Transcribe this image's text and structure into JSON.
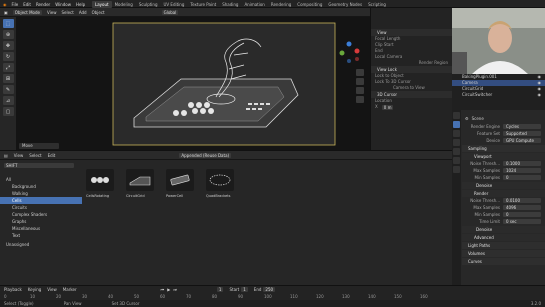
{
  "menu": [
    "File",
    "Edit",
    "Render",
    "Window",
    "Help"
  ],
  "workspaces": [
    "Layout",
    "Modeling",
    "Sculpting",
    "UV Editing",
    "Texture Paint",
    "Shading",
    "Animation",
    "Rendering",
    "Compositing",
    "Geometry Nodes",
    "Scripting"
  ],
  "viewport_header": {
    "mode": "Object Mode",
    "items": [
      "View",
      "Select",
      "Add",
      "Object"
    ],
    "orientation": "Global"
  },
  "viewport": {
    "move_label": "Move"
  },
  "npanel": {
    "section": "View",
    "focal_label": "Focal Length",
    "focal_value": "50 mm",
    "clip_start": "Clip Start",
    "clip_end": "End",
    "local_camera": "Local Camera",
    "render_region": "Render Region",
    "view_lock": "View Lock",
    "lock_obj": "Lock to Object",
    "lock": "Lock",
    "to_cursor": "To 3D Cursor",
    "camera_to_view": "Camera to View",
    "cursor_section": "3D Cursor",
    "location": "Location",
    "x": "X",
    "x_val": "0 m"
  },
  "outliner": {
    "items": [
      {
        "name": "BakingPlugin.001",
        "selected": false
      },
      {
        "name": "Camera",
        "selected": true
      },
      {
        "name": "CircuitGrid",
        "selected": false
      },
      {
        "name": "CircuitSwitcher",
        "selected": false
      }
    ]
  },
  "props": {
    "scene": "Scene",
    "render_engine_label": "Render Engine",
    "render_engine": "Cycles",
    "feature_set_label": "Feature Set",
    "feature_set": "Supported",
    "device_label": "Device",
    "device": "GPU Compute",
    "sampling": "Sampling",
    "viewport": "Viewport",
    "noise_label": "Noise Thresh...",
    "noise_val": "0.1000",
    "max_samples_label": "Max Samples",
    "max_samples": "1024",
    "min_samples_label": "Min Samples",
    "min_samples": "0",
    "denoise": "Denoise",
    "render": "Render",
    "r_noise_val": "0.0100",
    "r_max_samples": "4096",
    "r_min_samples": "0",
    "time_limit_label": "Time Limit",
    "time_limit": "0 sec",
    "r_denoise": "Denoise",
    "advanced": "Advanced",
    "light_paths": "Light Paths",
    "volumes": "Volumes",
    "curves": "Curves"
  },
  "browser": {
    "header": [
      "View",
      "Select",
      "Edit"
    ],
    "library": "Appended (Reuse Data)",
    "library_left": "SHIFT",
    "categories": [
      {
        "name": "All",
        "sel": false
      },
      {
        "name": "Background",
        "sel": false
      },
      {
        "name": "Walking",
        "sel": false
      },
      {
        "name": "Cells",
        "sel": true
      },
      {
        "name": "Circuits",
        "sel": false
      },
      {
        "name": "Complex Shaders",
        "sel": false
      },
      {
        "name": "Graphs",
        "sel": false
      },
      {
        "name": "Miscellaneous",
        "sel": false
      },
      {
        "name": "Text",
        "sel": false
      },
      {
        "name": "Unassigned",
        "sel": false
      }
    ],
    "assets": [
      "CellsRotating",
      "CircuitGrid",
      "PowerCell",
      "QuadBrackets"
    ]
  },
  "timeline": {
    "items": [
      "Playback",
      "Keying",
      "View",
      "Marker"
    ],
    "frame": "1",
    "start_label": "Start",
    "start": "1",
    "end_label": "End",
    "end": "250",
    "ticks": [
      "0",
      "10",
      "20",
      "30",
      "40",
      "50",
      "60",
      "70",
      "80",
      "90",
      "100",
      "110",
      "120",
      "130",
      "140",
      "150",
      "160"
    ]
  },
  "status": [
    "Select (Toggle)",
    "Pan View",
    "Set 3D Cursor"
  ],
  "version": "3.2.0",
  "accent": "#4772b3"
}
